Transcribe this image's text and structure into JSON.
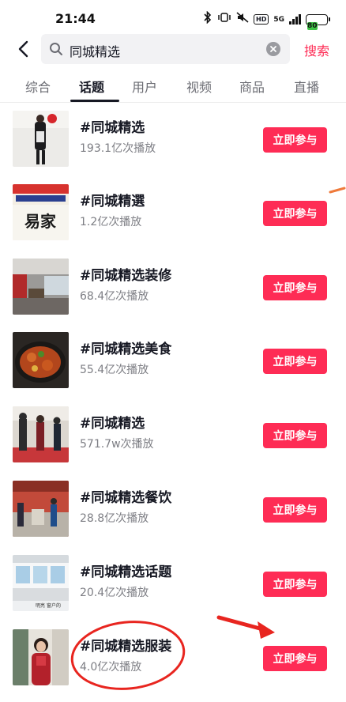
{
  "status_bar": {
    "time": "21:44",
    "network": "5G",
    "hd": "HD",
    "battery": "80"
  },
  "search": {
    "query": "同城精选",
    "submit_label": "搜索",
    "icons": [
      "back-arrow-icon",
      "search-icon",
      "clear-icon"
    ]
  },
  "tabs": [
    {
      "label": "综合",
      "active": false
    },
    {
      "label": "话题",
      "active": true
    },
    {
      "label": "用户",
      "active": false
    },
    {
      "label": "视频",
      "active": false
    },
    {
      "label": "商品",
      "active": false
    },
    {
      "label": "直播",
      "active": false
    }
  ],
  "topics": [
    {
      "title": "#同城精选",
      "views": "193.1亿次播放",
      "button": "立即参与"
    },
    {
      "title": "#同城精選",
      "views": "1.2亿次播放",
      "button": "立即参与"
    },
    {
      "title": "#同城精选装修",
      "views": "68.4亿次播放",
      "button": "立即参与"
    },
    {
      "title": "#同城精选美食",
      "views": "55.4亿次播放",
      "button": "立即参与"
    },
    {
      "title": "#同城精选",
      "views": "571.7w次播放",
      "button": "立即参与"
    },
    {
      "title": "#同城精选餐饮",
      "views": "28.8亿次播放",
      "button": "立即参与"
    },
    {
      "title": "#同城精选话题",
      "views": "20.4亿次播放",
      "button": "立即参与"
    },
    {
      "title": "#同城精选服装",
      "views": "4.0亿次播放",
      "button": "立即参与"
    }
  ],
  "thumbnail_text": {
    "item2": "易家",
    "item7": "明亮 窗户的"
  },
  "colors": {
    "accent": "#fe2c55",
    "annotation": "#e8251f",
    "text_primary": "#161823",
    "text_secondary": "#7d7e84"
  }
}
